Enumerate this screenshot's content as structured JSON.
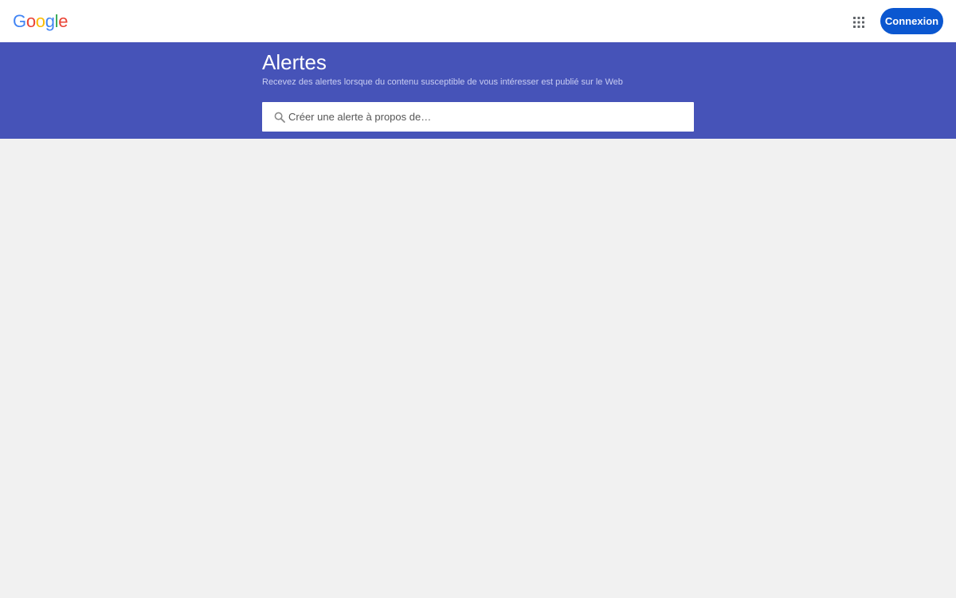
{
  "header": {
    "logo": {
      "letters": [
        "G",
        "o",
        "o",
        "g",
        "l",
        "e"
      ],
      "colors": [
        "#4285f4",
        "#ea4335",
        "#fbbc05",
        "#4285f4",
        "#34a853",
        "#ea4335"
      ]
    },
    "apps_icon": "apps-grid-icon",
    "signin_label": "Connexion"
  },
  "hero": {
    "title": "Alertes",
    "subtitle": "Recevez des alertes lorsque du contenu susceptible de vous intéresser est publié sur le Web",
    "background": "#4653b8"
  },
  "search": {
    "icon": "search-icon",
    "placeholder": "Créer une alerte à propos de…",
    "value": ""
  }
}
